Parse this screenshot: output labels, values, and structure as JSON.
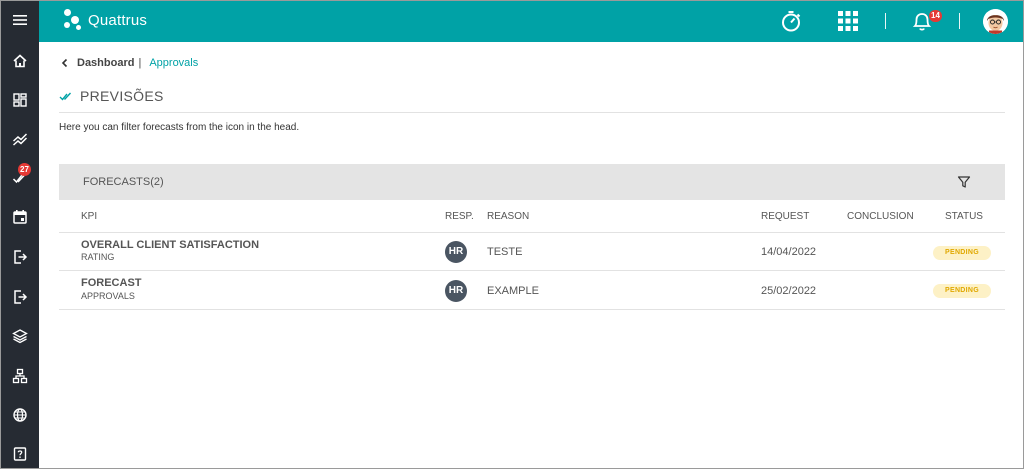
{
  "header": {
    "app_name": "Quattrus",
    "notification_count": "14"
  },
  "sidebar": {
    "badge_count": "27"
  },
  "breadcrumb": {
    "root": "Dashboard",
    "separator": "|",
    "current": "Approvals"
  },
  "page": {
    "title": "PREVISÕES",
    "description": "Here you can filter forecasts from the icon in the head."
  },
  "card": {
    "title": "FORECASTS(2)"
  },
  "table": {
    "columns": {
      "kpi": "KPI",
      "resp": "RESP.",
      "reason": "REASON",
      "request": "REQUEST",
      "conclusion": "CONCLUSION",
      "status": "STATUS"
    },
    "rows": [
      {
        "kpi": "OVERALL CLIENT SATISFACTION",
        "kpi_sub": "RATING",
        "resp": "HR",
        "reason": "TESTE",
        "request": "14/04/2022",
        "conclusion": "",
        "status": "PENDING"
      },
      {
        "kpi": "FORECAST",
        "kpi_sub": "APPROVALS",
        "resp": "HR",
        "reason": "EXAMPLE",
        "request": "25/02/2022",
        "conclusion": "",
        "status": "PENDING"
      }
    ]
  },
  "colors": {
    "header": "#00a2a6",
    "sidebar": "#262b33",
    "badge": "#e53935",
    "pending_bg": "#fdf1c6",
    "pending_text": "#e0a800"
  },
  "icons": {
    "sidebar": [
      "menu-icon",
      "home-icon",
      "dashboard-icon",
      "trend-icon",
      "approvals-check-icon",
      "calendar-icon",
      "logout-icon",
      "exit-icon",
      "layers-icon",
      "hierarchy-icon",
      "globe-icon",
      "help-icon"
    ],
    "header": [
      "stopwatch-icon",
      "apps-grid-icon",
      "bell-icon",
      "avatar"
    ]
  }
}
